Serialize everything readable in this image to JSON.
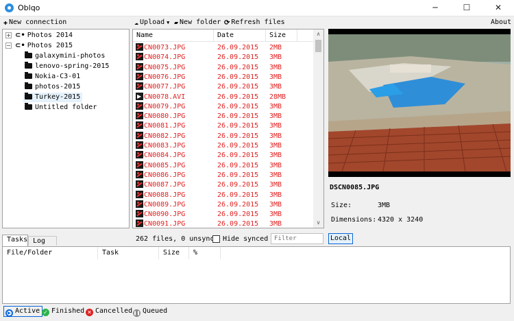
{
  "window": {
    "title": "Oblqo",
    "minimize": "─",
    "maximize": "☐",
    "close": "✕"
  },
  "toolbar": {
    "new_connection": "New connection",
    "upload": "Upload",
    "new_folder": "New folder",
    "refresh_files": "Refresh files",
    "about": "About"
  },
  "tree": {
    "items": [
      {
        "label": "Photos 2014",
        "toggle": "+",
        "icon": "plug-icon"
      },
      {
        "label": "Photos 2015",
        "toggle": "−",
        "icon": "plug-icon"
      },
      {
        "label": "galaxymini-photos",
        "icon": "folder-icon"
      },
      {
        "label": "lenovo-spring-2015",
        "icon": "folder-icon"
      },
      {
        "label": "Nokia-C3-01",
        "icon": "folder-icon"
      },
      {
        "label": "photos-2015",
        "icon": "folder-icon"
      },
      {
        "label": "Turkey-2015",
        "icon": "folder-icon"
      },
      {
        "label": "Untitled folder",
        "icon": "folder-icon"
      }
    ]
  },
  "file_list": {
    "columns": [
      "Name",
      "Date",
      "Size"
    ],
    "rows": [
      {
        "name": "DSCN0073.JPG",
        "date": "26.09.2015",
        "size": "2MB",
        "type": "image"
      },
      {
        "name": "DSCN0074.JPG",
        "date": "26.09.2015",
        "size": "3MB",
        "type": "image"
      },
      {
        "name": "DSCN0075.JPG",
        "date": "26.09.2015",
        "size": "3MB",
        "type": "image"
      },
      {
        "name": "DSCN0076.JPG",
        "date": "26.09.2015",
        "size": "3MB",
        "type": "image"
      },
      {
        "name": "DSCN0077.JPG",
        "date": "26.09.2015",
        "size": "3MB",
        "type": "image"
      },
      {
        "name": "DSCN0078.AVI",
        "date": "26.09.2015",
        "size": "28MB",
        "type": "video"
      },
      {
        "name": "DSCN0079.JPG",
        "date": "26.09.2015",
        "size": "3MB",
        "type": "image"
      },
      {
        "name": "DSCN0080.JPG",
        "date": "26.09.2015",
        "size": "3MB",
        "type": "image"
      },
      {
        "name": "DSCN0081.JPG",
        "date": "26.09.2015",
        "size": "3MB",
        "type": "image"
      },
      {
        "name": "DSCN0082.JPG",
        "date": "26.09.2015",
        "size": "3MB",
        "type": "image"
      },
      {
        "name": "DSCN0083.JPG",
        "date": "26.09.2015",
        "size": "3MB",
        "type": "image"
      },
      {
        "name": "DSCN0084.JPG",
        "date": "26.09.2015",
        "size": "3MB",
        "type": "image"
      },
      {
        "name": "DSCN0085.JPG",
        "date": "26.09.2015",
        "size": "3MB",
        "type": "image"
      },
      {
        "name": "DSCN0086.JPG",
        "date": "26.09.2015",
        "size": "3MB",
        "type": "image"
      },
      {
        "name": "DSCN0087.JPG",
        "date": "26.09.2015",
        "size": "3MB",
        "type": "image"
      },
      {
        "name": "DSCN0088.JPG",
        "date": "26.09.2015",
        "size": "3MB",
        "type": "image"
      },
      {
        "name": "DSCN0089.JPG",
        "date": "26.09.2015",
        "size": "3MB",
        "type": "image"
      },
      {
        "name": "DSCN0090.JPG",
        "date": "26.09.2015",
        "size": "3MB",
        "type": "image"
      },
      {
        "name": "DSCN0091.JPG",
        "date": "26.09.2015",
        "size": "3MB",
        "type": "image"
      }
    ],
    "status": "262 files, 0 unsync",
    "hide_synced_label": "Hide synced",
    "filter_placeholder": "Filter",
    "local_button": "Local"
  },
  "preview": {
    "filename": "DSCN0085.JPG",
    "size_label": "Size:",
    "size_value": "3MB",
    "dimensions_label": "Dimensions:",
    "dimensions_value": "4320 x 3240"
  },
  "tasks": {
    "tabs": [
      "Tasks",
      "Log"
    ],
    "columns": [
      "File/Folder",
      "Task",
      "Size",
      "%"
    ]
  },
  "legend": {
    "active": "Active",
    "finished": "Finished",
    "cancelled": "Cancelled",
    "queued": "Queued"
  },
  "colors": {
    "unsynced_text": "#e02020",
    "accent": "#0a64d6"
  }
}
